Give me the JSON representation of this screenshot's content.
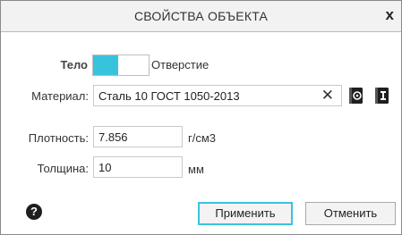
{
  "window": {
    "title": "СВОЙСТВА ОБЪЕКТА",
    "close_glyph": "x"
  },
  "mode": {
    "body_label": "Тело",
    "hole_label": "Отверстие",
    "selected": "Тело",
    "accent_color": "#38c3dd"
  },
  "material": {
    "label": "Материал:",
    "value": "Сталь 10 ГОСТ 1050-2013",
    "clear_glyph": "✕",
    "icons": [
      "material-library-icon",
      "material-info-icon"
    ]
  },
  "density": {
    "label": "Плотность:",
    "value": "7.856",
    "unit": "г/см3"
  },
  "thickness": {
    "label": "Толщина:",
    "value": "10",
    "unit": "мм"
  },
  "footer": {
    "help_glyph": "?",
    "apply_label": "Применить",
    "cancel_label": "Отменить"
  }
}
